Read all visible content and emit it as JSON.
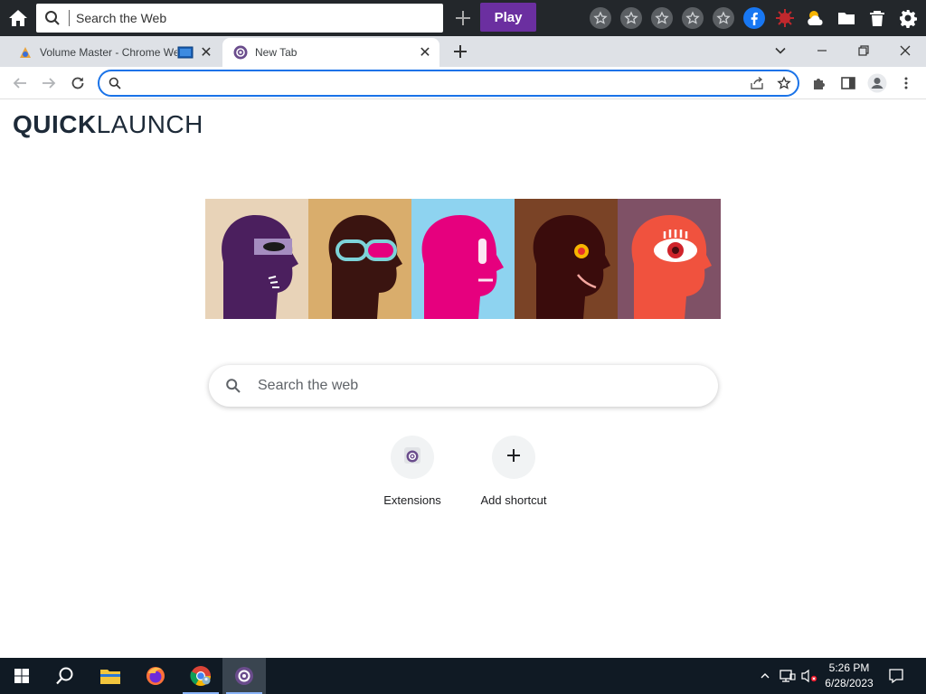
{
  "toolbar": {
    "search_placeholder": "Search the Web",
    "play_label": "Play",
    "star_count": 5
  },
  "tabs": [
    {
      "title": "Volume Master - Chrome We",
      "active": false
    },
    {
      "title": "New Tab",
      "active": true
    }
  ],
  "address_bar": {
    "value": ""
  },
  "page": {
    "logo_bold": "QUICK",
    "logo_light": "LAUNCH",
    "search_placeholder": "Search the web",
    "shortcuts": [
      {
        "label": "Extensions",
        "icon": "extension-app-icon"
      },
      {
        "label": "Add shortcut",
        "icon": "plus-icon"
      }
    ]
  },
  "taskbar": {
    "time": "5:26 PM",
    "date": "6/28/2023"
  },
  "colors": {
    "accent": "#1a73e8",
    "play_button": "#6b2fa0",
    "topbar_bg": "#23272b",
    "taskbar_bg": "#101a24",
    "hero_panels": [
      "#e8d3b8",
      "#d9ad6c",
      "#8ed3f0",
      "#7a4326",
      "#7f5166"
    ]
  }
}
